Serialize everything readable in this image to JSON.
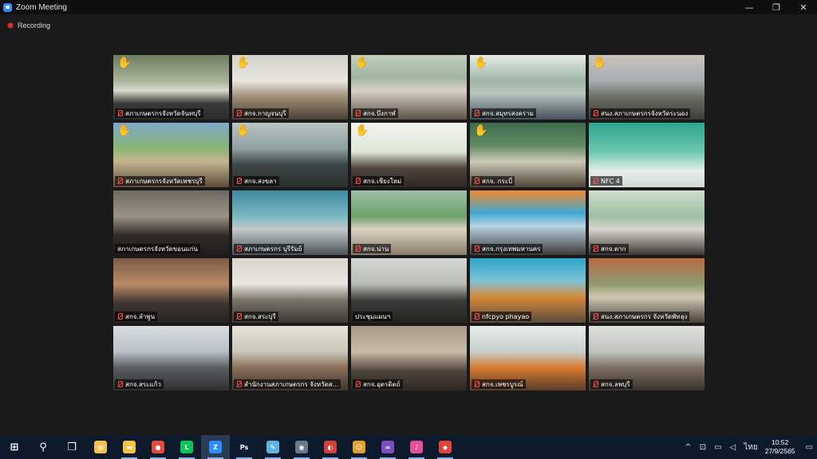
{
  "window": {
    "title": "Zoom Meeting",
    "controls": {
      "minimize": "—",
      "restore": "❐",
      "close": "✕"
    }
  },
  "recording": {
    "label": "Recording"
  },
  "colors": {
    "accent": "#2d8cff",
    "recording": "#e02f2f",
    "muted": "#ff4b4b",
    "active_speaker": "#d7e36a",
    "raise_hand": "#f4b400"
  },
  "participants": [
    {
      "name": "สภาเกษตรกรจังหวัดจันทบุรี",
      "muted": true,
      "hand": true,
      "icon": "raise-hand-icon"
    },
    {
      "name": "สกจ.กาญจนบุรี",
      "muted": true,
      "hand": true,
      "icon": "raise-hand-icon"
    },
    {
      "name": "สกจ.บึงกาฬ",
      "muted": true,
      "hand": true,
      "icon": "raise-hand-icon"
    },
    {
      "name": "สกจ.สมุทรสงคราม",
      "muted": true,
      "hand": true,
      "icon": "raise-hand-icon"
    },
    {
      "name": "สนง.สภาเกษตรกรจังหวัดระนอง",
      "muted": true,
      "hand": true,
      "icon": "raise-hand-icon"
    },
    {
      "name": "สภาเกษตรกรจังหวัดเพชรบุรี",
      "muted": true,
      "hand": true,
      "icon": "raise-hand-icon"
    },
    {
      "name": "สกจ.สงขลา",
      "muted": true,
      "hand": true,
      "icon": "raise-hand-icon"
    },
    {
      "name": "สกจ.เชียงใหม่",
      "muted": true,
      "hand": true,
      "icon": "raise-hand-icon"
    },
    {
      "name": "สกจ. กระบี่",
      "muted": true,
      "hand": true,
      "icon": "raise-hand-icon"
    },
    {
      "name": "NFC 4",
      "muted": true,
      "hand": false
    },
    {
      "name": "สภาเกษตรกรจังหวัดขอนแก่น",
      "muted": false,
      "hand": false,
      "active": true
    },
    {
      "name": "สภาเกษตรกร บุรีรัมย์",
      "muted": true,
      "hand": false
    },
    {
      "name": "สกจ.น่าน",
      "muted": true,
      "hand": false
    },
    {
      "name": "สกจ.กรุงเทพมหานคร",
      "muted": true,
      "hand": false
    },
    {
      "name": "สกจ.ตาก",
      "muted": true,
      "hand": false
    },
    {
      "name": "สกจ.ลำพูน",
      "muted": true,
      "hand": false
    },
    {
      "name": "สกจ.สระบุรี",
      "muted": true,
      "hand": false
    },
    {
      "name": "ประชุมแผนฯ",
      "muted": false,
      "hand": false
    },
    {
      "name": "nfcpyo phayao",
      "muted": true,
      "hand": false
    },
    {
      "name": "สนง.สภาเกษตรกร จังหวัดพัทลุง",
      "muted": true,
      "hand": false
    },
    {
      "name": "สกจ.สระแก้ว",
      "muted": true,
      "hand": false
    },
    {
      "name": "สำนักงานสภาเกษตรกร จังหวัดส...",
      "muted": true,
      "hand": false
    },
    {
      "name": "สกจ.อุตรดิตถ์",
      "muted": true,
      "hand": false
    },
    {
      "name": "สกจ.เพชรบูรณ์",
      "muted": true,
      "hand": false
    },
    {
      "name": "สกจ.ลพบุรี",
      "muted": true,
      "hand": false
    }
  ],
  "taskbar": {
    "items": [
      {
        "name": "windows-start-icon",
        "glyph": "⊞",
        "color": "#ffffff"
      },
      {
        "name": "search-icon",
        "glyph": "⚲",
        "color": "#ffffff"
      },
      {
        "name": "task-view-icon",
        "glyph": "❐",
        "color": "#ffffff"
      },
      {
        "name": "explorer-pin-icon",
        "glyph": "▤",
        "color": "#f2c14e"
      },
      {
        "name": "file-explorer-icon",
        "glyph": "▬",
        "color": "#f4c542"
      },
      {
        "name": "chrome-icon",
        "glyph": "●",
        "color": "#e64a3b"
      },
      {
        "name": "line-icon",
        "glyph": "L",
        "color": "#06c755"
      },
      {
        "name": "zoom-icon",
        "glyph": "Z",
        "color": "#2d8cff"
      },
      {
        "name": "photoshop-icon",
        "glyph": "Ps",
        "color": "#0b1a35"
      },
      {
        "name": "notes-icon",
        "glyph": "✎",
        "color": "#5fb4e6"
      },
      {
        "name": "camera-icon",
        "glyph": "◉",
        "color": "#6a7a8c"
      },
      {
        "name": "paint-icon",
        "glyph": "◐",
        "color": "#d43f3a"
      },
      {
        "name": "user-app-icon",
        "glyph": "☺",
        "color": "#e0a12f"
      },
      {
        "name": "visual-studio-icon",
        "glyph": "∞",
        "color": "#7b4ec4"
      },
      {
        "name": "itunes-icon",
        "glyph": "♪",
        "color": "#e64d9d"
      },
      {
        "name": "anydesk-icon",
        "glyph": "◆",
        "color": "#e0433a"
      }
    ],
    "tray": {
      "chevron": "^",
      "ime_label": "ไทย",
      "time": "10:52",
      "date": "27/9/2565",
      "notification": "▭"
    }
  }
}
